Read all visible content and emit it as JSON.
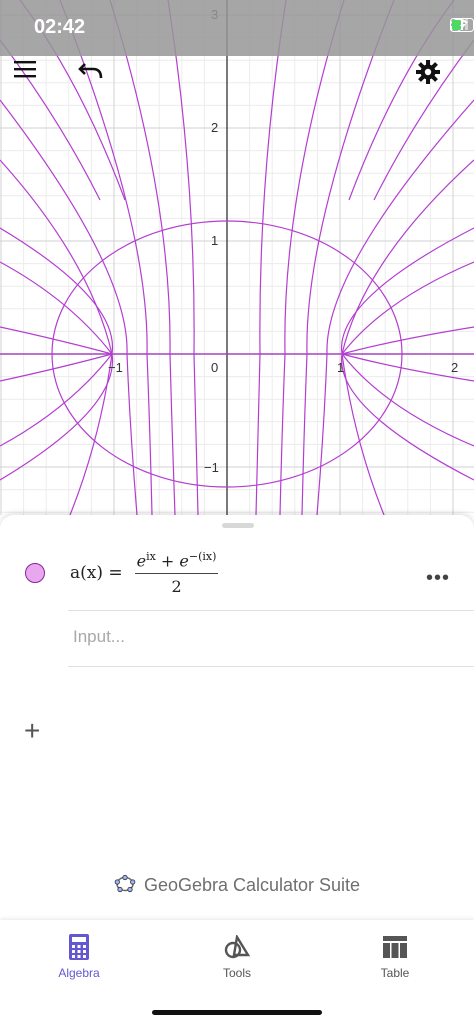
{
  "status_bar": {
    "time": "02:42"
  },
  "graph": {
    "x_ticks": [
      "−1",
      "0",
      "1",
      "2"
    ],
    "y_ticks": [
      "3",
      "2",
      "1",
      "−1"
    ],
    "curve_color": "#b43dd1"
  },
  "algebra": {
    "function_name": "a(x) =",
    "numerator": "e",
    "exp1": "ix",
    "plus": " + ",
    "exp2": "−(ix)",
    "denominator": "2",
    "more_label": "•••",
    "input_placeholder": "Input..."
  },
  "suite_label": "GeoGebra Calculator Suite",
  "nav": {
    "algebra": "Algebra",
    "tools": "Tools",
    "table": "Table",
    "active_color": "#6557d2"
  }
}
